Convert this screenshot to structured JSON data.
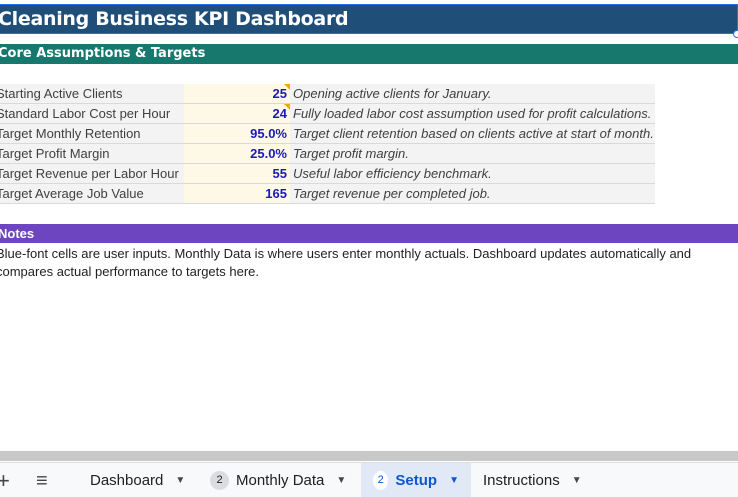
{
  "title": "Cleaning Business KPI Dashboard",
  "section_title": "Core Assumptions & Targets",
  "assumptions": [
    {
      "label": "Starting Active Clients",
      "value": "25",
      "note": "Opening active clients for January."
    },
    {
      "label": "Standard Labor Cost per Hour",
      "value": "24",
      "note": "Fully loaded labor cost assumption used for profit calculations."
    },
    {
      "label": "Target Monthly Retention",
      "value": "95.0%",
      "note": "Target client retention based on clients active at start of month."
    },
    {
      "label": "Target Profit Margin",
      "value": "25.0%",
      "note": "Target profit margin."
    },
    {
      "label": "Target Revenue per Labor Hour",
      "value": "55",
      "note": "Useful labor efficiency benchmark."
    },
    {
      "label": "Target Average Job Value",
      "value": "165",
      "note": "Target revenue per completed job."
    }
  ],
  "notes": {
    "title": "Notes",
    "text": "Blue-font cells are user inputs. Monthly Data is where users enter monthly actuals. Dashboard updates automatically and compares actual performance to targets here."
  },
  "sheet_tabs": {
    "add_icon": "+",
    "list_icon": "≡",
    "tabs": [
      {
        "label": "Dashboard",
        "count": ""
      },
      {
        "label": "Monthly Data",
        "count": "2"
      },
      {
        "label": "Setup",
        "count": "2"
      },
      {
        "label": "Instructions",
        "count": ""
      }
    ],
    "active_tab": "Setup"
  },
  "colors": {
    "title_band": "#1f4e79",
    "section_band": "#17786e",
    "notes_band": "#6d45c1",
    "input_font": "#1a1ab8",
    "input_fill": "#fef9e7"
  }
}
